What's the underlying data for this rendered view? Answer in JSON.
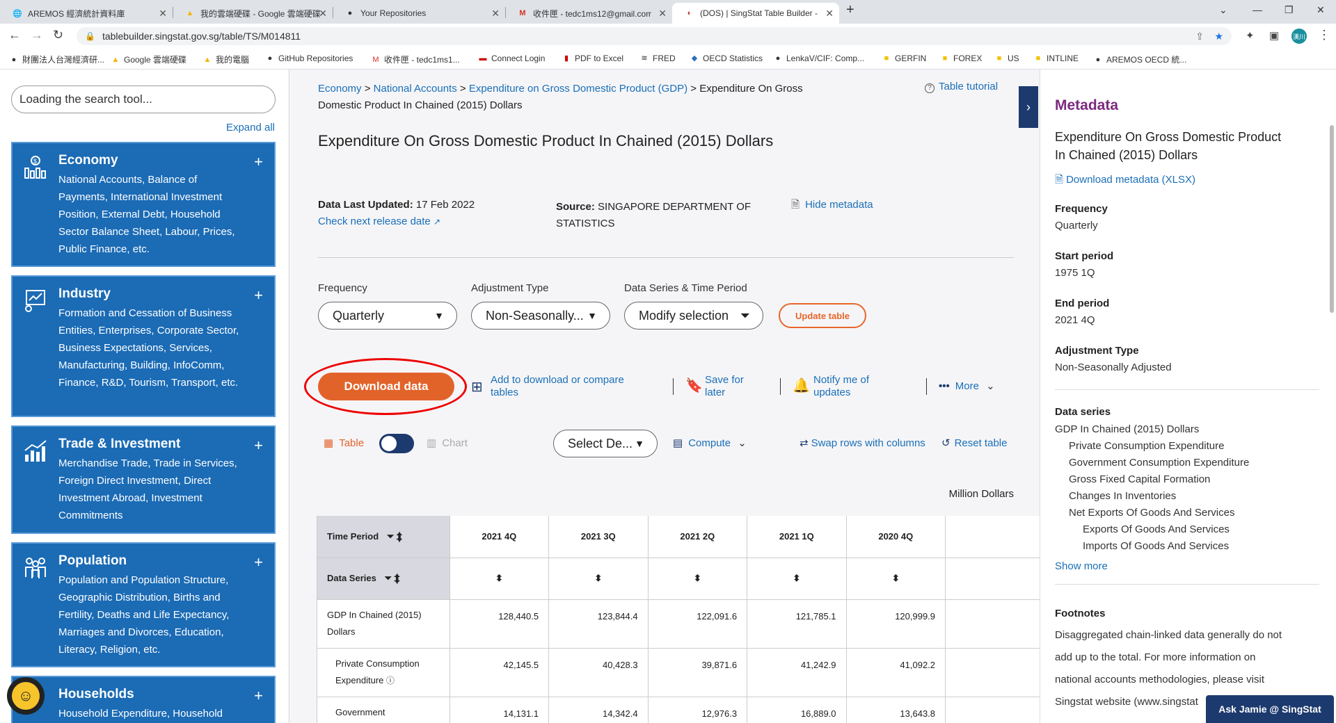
{
  "browser": {
    "tabs": [
      {
        "title": "AREMOS 經濟統計資料庫",
        "icon": "globe-icon"
      },
      {
        "title": "我的雲端硬碟 - Google 雲端硬碟",
        "icon": "google-drive-icon"
      },
      {
        "title": "Your Repositories",
        "icon": "github-icon"
      },
      {
        "title": "收件匣 - tedc1ms12@gmail.com",
        "icon": "gmail-icon"
      },
      {
        "title": "(DOS) | SingStat Table Builder - ",
        "icon": "singstat-icon"
      }
    ],
    "url": "tablebuilder.singstat.gov.sg/table/TS/M014811",
    "profile": "漢川",
    "bookmarks": [
      "財團法人台灣經濟研...",
      "Google 雲端硬碟",
      "我的電腦",
      "GitHub Repositories",
      "收件匣 - tedc1ms1...",
      "Connect Login",
      "PDF to Excel",
      "FRED",
      "OECD Statistics",
      "LenkaV/CIF: Comp...",
      "GERFIN",
      "FOREX",
      "US",
      "INTLINE",
      "AREMOS OECD 統..."
    ]
  },
  "sidebar": {
    "search_placeholder": "Loading the search tool...",
    "expand_all": "Expand all",
    "categories": [
      {
        "title": "Economy",
        "desc": "National Accounts, Balance of Payments, International Investment Position, External Debt, Household Sector Balance Sheet, Labour, Prices, Public Finance, etc."
      },
      {
        "title": "Industry",
        "desc": "Formation and Cessation of Business Entities, Enterprises, Corporate Sector, Business Expectations, Services, Manufacturing, Building, InfoComm, Finance, R&D, Tourism, Transport, etc."
      },
      {
        "title": "Trade & Investment",
        "desc": "Merchandise Trade, Trade in Services, Foreign Direct Investment, Direct Investment Abroad, Investment Commitments"
      },
      {
        "title": "Population",
        "desc": "Population and Population Structure, Geographic Distribution, Births and Fertility, Deaths and Life Expectancy, Marriages and Divorces, Education, Literacy, Religion, etc."
      },
      {
        "title": "Households",
        "desc": "Household Expenditure, Household"
      }
    ]
  },
  "breadcrumb": {
    "items": [
      "Economy",
      "National Accounts",
      "Expenditure on Gross Domestic Product (GDP)"
    ],
    "current_line1": "Expenditure On Gross",
    "current_line2": "Domestic Product In Chained (2015) Dollars",
    "tutorial": "Table tutorial"
  },
  "main": {
    "title": "Expenditure On Gross Domestic Product In Chained (2015) Dollars",
    "last_updated_label": "Data Last Updated:",
    "last_updated_value": "17 Feb 2022",
    "check_release": "Check next release date",
    "source_label": "Source:",
    "source_value_1": "SINGAPORE DEPARTMENT OF",
    "source_value_2": "STATISTICS",
    "hide_metadata": "Hide metadata",
    "frequency_label": "Frequency",
    "frequency_value": "Quarterly",
    "adjustment_label": "Adjustment Type",
    "adjustment_value": "Non-Seasonally...",
    "series_label": "Data Series & Time Period",
    "modify_selection": "Modify selection",
    "update_table": "Update table",
    "download_data": "Download data",
    "add_compare_1": "Add to download or compare",
    "add_compare_2": "tables",
    "save_later_1": "Save for",
    "save_later_2": "later",
    "notify_1": "Notify me of",
    "notify_2": "updates",
    "more": "More",
    "table_toggle": "Table",
    "chart_toggle": "Chart",
    "select_dec": "Select De...",
    "compute": "Compute",
    "swap": "Swap rows with columns",
    "reset": "Reset table",
    "unit": "Million Dollars"
  },
  "table": {
    "time_period_label": "Time Period",
    "data_series_label": "Data Series",
    "columns": [
      "2021 4Q",
      "2021 3Q",
      "2021 2Q",
      "2021 1Q",
      "2020 4Q"
    ],
    "rows": [
      {
        "label1": "GDP In Chained (2015)",
        "label2": "Dollars",
        "values": [
          "128,440.5",
          "123,844.4",
          "122,091.6",
          "121,785.1",
          "120,999.9"
        ]
      },
      {
        "label1": "Private Consumption",
        "label2": "Expenditure",
        "values": [
          "42,145.5",
          "40,428.3",
          "39,871.6",
          "41,242.9",
          "41,092.2"
        ]
      },
      {
        "label1": "Government",
        "label2": "",
        "values": [
          "14,131.1",
          "14,342.4",
          "12,976.3",
          "16,889.0",
          "13,643.8"
        ]
      }
    ]
  },
  "metadata": {
    "heading": "Metadata",
    "title_1": "Expenditure On Gross Domestic Product",
    "title_2": "In Chained (2015) Dollars",
    "download": "Download metadata (XLSX)",
    "frequency_label": "Frequency",
    "frequency_value": "Quarterly",
    "start_label": "Start period",
    "start_value": "1975 1Q",
    "end_label": "End period",
    "end_value": "2021 4Q",
    "adj_label": "Adjustment Type",
    "adj_value": "Non-Seasonally Adjusted",
    "series_label": "Data series",
    "series": [
      "GDP In Chained (2015) Dollars",
      "Private Consumption Expenditure",
      "Government Consumption Expenditure",
      "Gross Fixed Capital Formation",
      "Changes In Inventories",
      "Net Exports Of Goods And Services",
      "Exports Of Goods And Services",
      "Imports Of Goods And Services"
    ],
    "show_more": "Show more",
    "footnotes_label": "Footnotes",
    "footnote_lines": [
      "Disaggregated chain-linked data generally do not",
      "add up to the total. For more information on",
      "national accounts methodologies, please visit",
      "Singstat website (www.singstat"
    ],
    "ask_jamie": "Ask Jamie @ SingStat"
  }
}
